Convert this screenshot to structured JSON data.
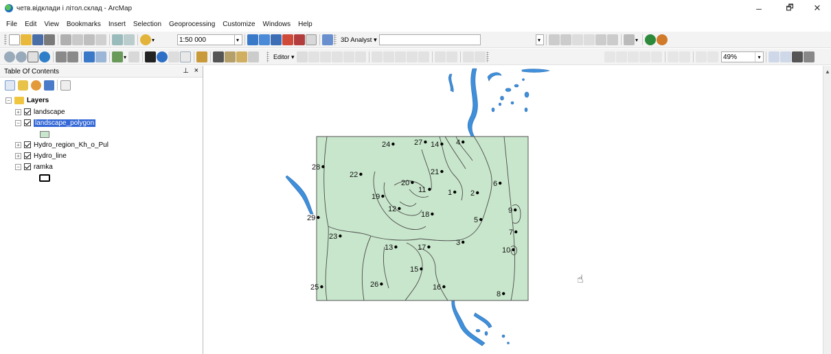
{
  "window": {
    "title": "четв.відклади і літол.склад - ArcMap",
    "minimize": "–",
    "maximize": "🗗",
    "close": "✕"
  },
  "menu": [
    "File",
    "Edit",
    "View",
    "Bookmarks",
    "Insert",
    "Selection",
    "Geoprocessing",
    "Customize",
    "Windows",
    "Help"
  ],
  "toolbar": {
    "scale": "1:50 000",
    "analyst_3d": "3D Analyst ▾",
    "editor": "Editor ▾",
    "zoom": "49%"
  },
  "toc": {
    "title": "Table Of Contents",
    "pin": "ᵖ",
    "close": "×",
    "root": "Layers",
    "layers": [
      {
        "name": "landscape",
        "checked": true,
        "expanded": false
      },
      {
        "name": "landscape_polygon",
        "checked": true,
        "expanded": true,
        "selected": true
      },
      {
        "name": "Hydro_region_Kh_o_Pul",
        "checked": true,
        "expanded": false
      },
      {
        "name": "Hydro_line",
        "checked": true,
        "expanded": false
      },
      {
        "name": "ramka",
        "checked": true,
        "expanded": true
      }
    ]
  },
  "map": {
    "polygon_fill": "#c8e6cb",
    "water_color": "#3f8fdb",
    "points": [
      "1",
      "2",
      "3",
      "4",
      "5",
      "6",
      "7",
      "8",
      "9",
      "10",
      "11",
      "12",
      "13",
      "14",
      "15",
      "16",
      "17",
      "18",
      "19",
      "20",
      "21",
      "22",
      "23",
      "24",
      "25",
      "26",
      "27",
      "28",
      "29"
    ]
  },
  "cursor": {
    "icon": "hand-pan-icon",
    "glyph": "☝"
  }
}
